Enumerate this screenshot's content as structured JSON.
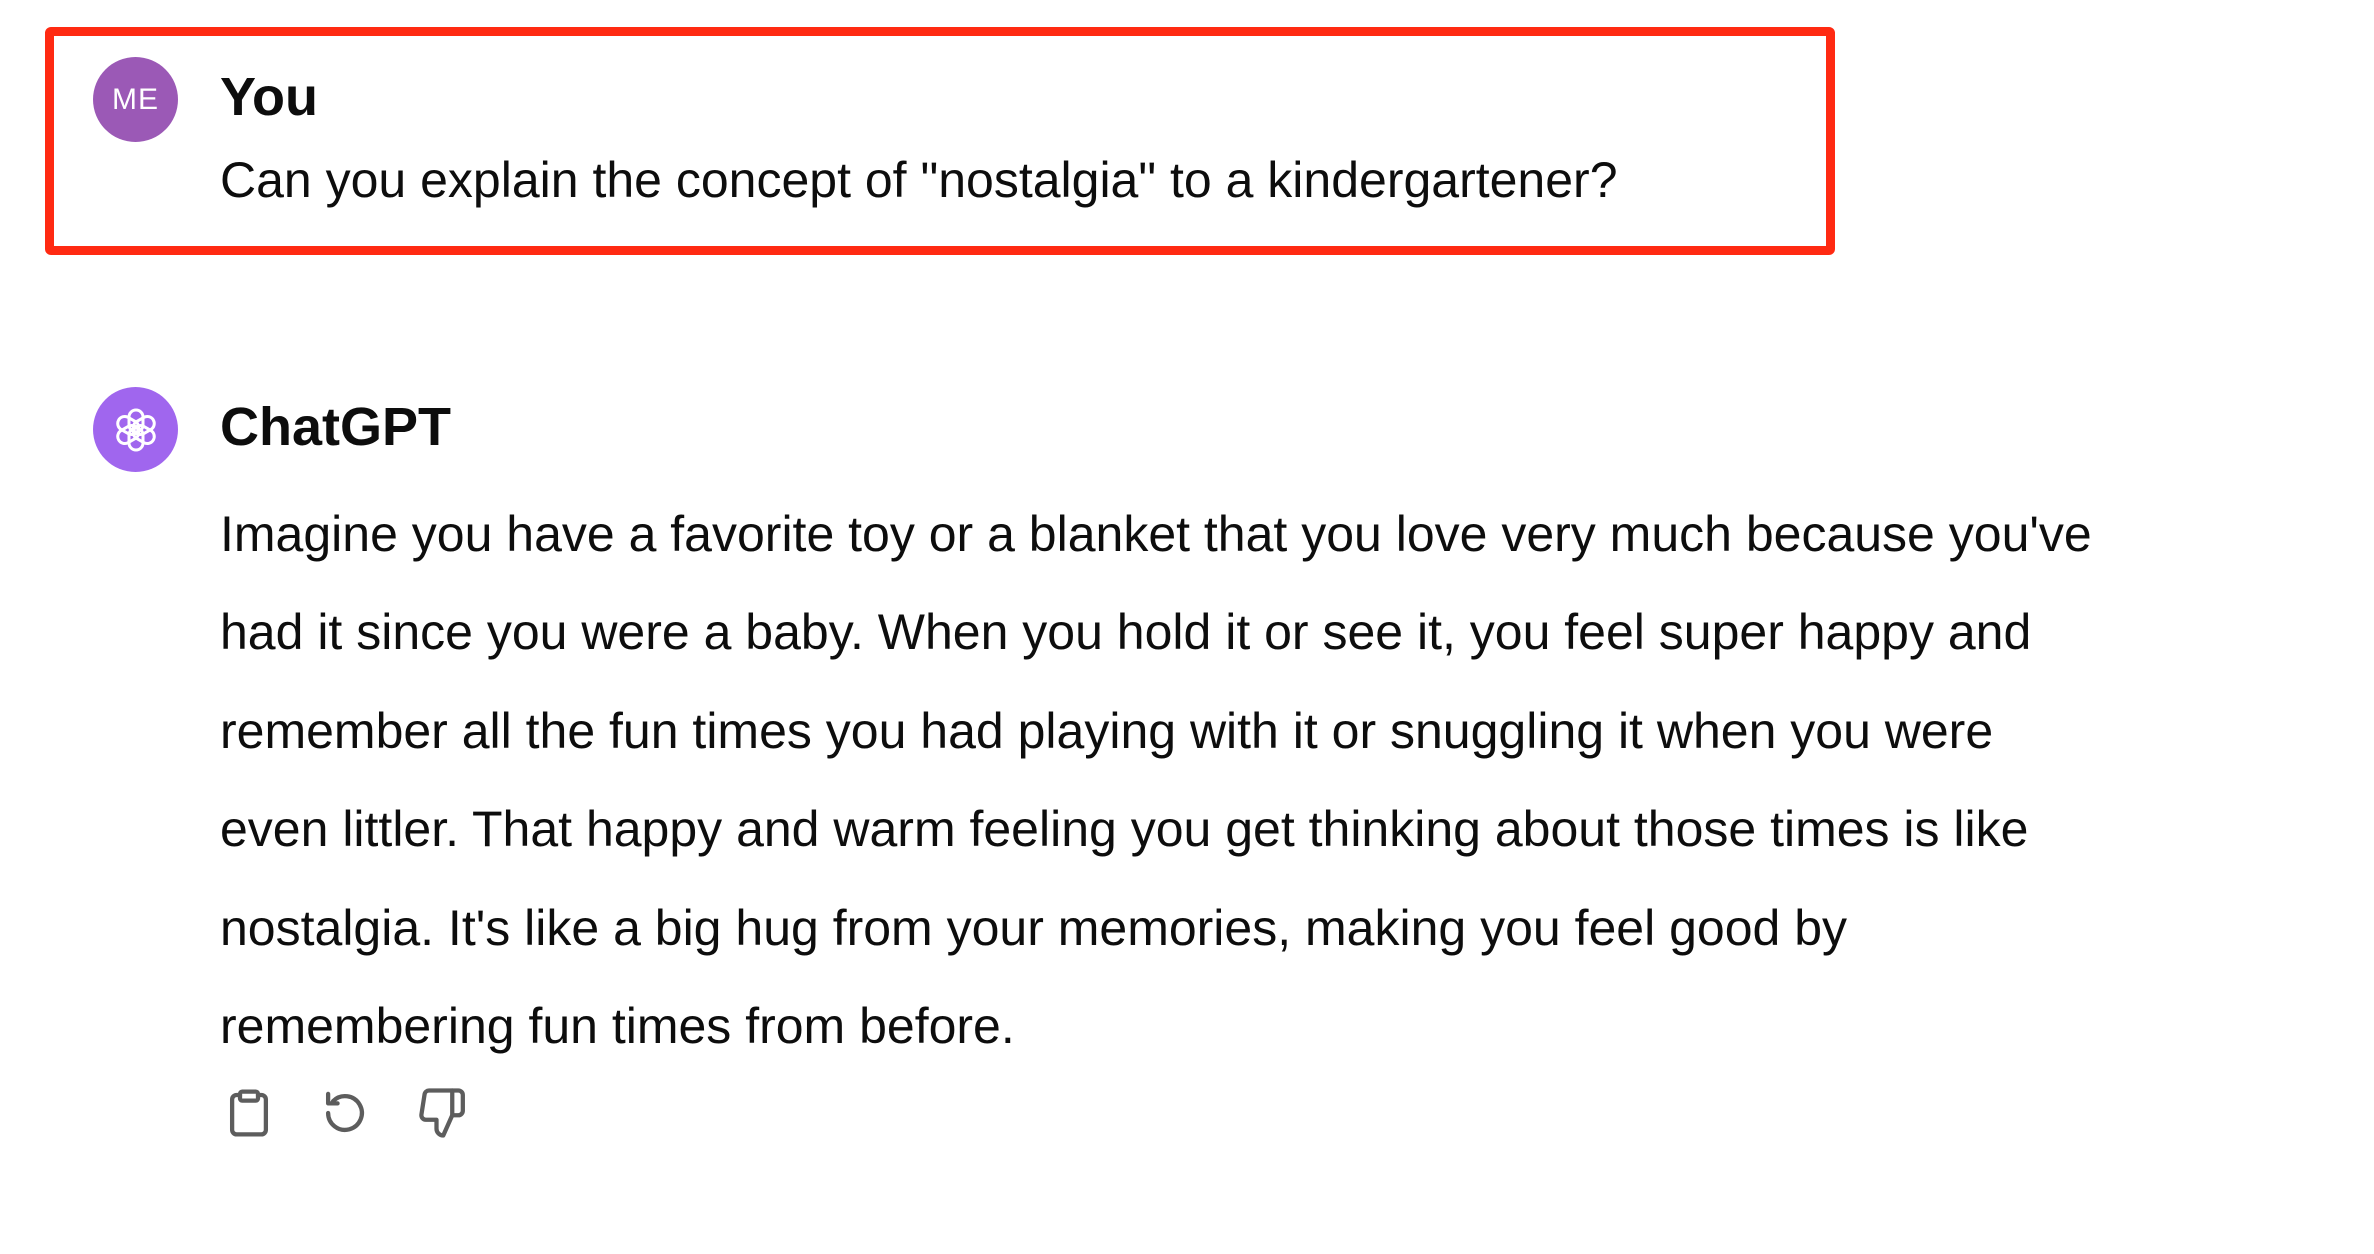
{
  "conversation": {
    "user_message": {
      "avatar_initials": "ME",
      "author": "You",
      "text": "Can you explain the concept of \"nostalgia\" to a kindergartener?",
      "highlight_color": "#ff2a12"
    },
    "assistant_message": {
      "author": "ChatGPT",
      "avatar_icon": "openai-logo-icon",
      "avatar_color": "#a066ee",
      "lines": [
        "Imagine you have a favorite toy or a blanket that you love very much because you've",
        "had it since you were a baby. When you hold it or see it, you feel super happy and",
        "remember all the fun times you had playing with it or snuggling it when you were",
        "even littler. That happy and warm feeling you get thinking about those times is like",
        "nostalgia. It's like a big hug from your memories, making you feel good by",
        "remembering fun times from before."
      ]
    },
    "actions": [
      {
        "icon": "clipboard-icon"
      },
      {
        "icon": "regenerate-icon"
      },
      {
        "icon": "thumbs-down-icon"
      }
    ]
  }
}
